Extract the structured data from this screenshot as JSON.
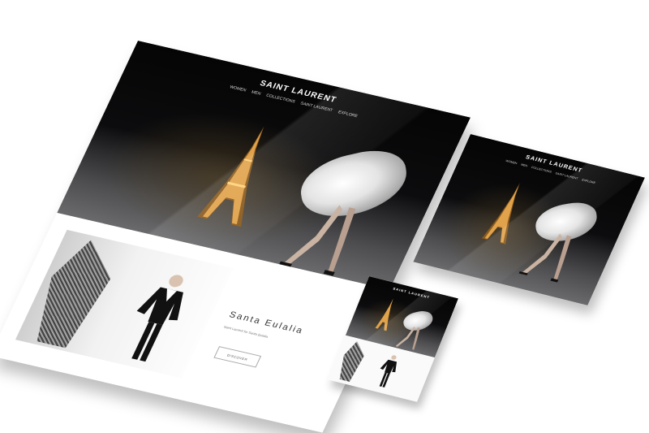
{
  "brand": "SAINT LAURENT",
  "nav": [
    "WOMEN",
    "MEN",
    "COLLECTIONS",
    "SAINT LAURENT",
    "EXPLORE"
  ],
  "feature": {
    "title": "Santa Eulalia",
    "description": "Saint Laurent for Santa Eulalia",
    "button_label": "DISCOVER"
  },
  "colors": {
    "hero_dark": "#050505",
    "page_bg": "#ffffff",
    "text_light": "#ffffff",
    "button_border": "#aaaaaa"
  },
  "icons": {
    "tower": "eiffel-tower-illustration",
    "figure": "model-figure-illustration"
  }
}
